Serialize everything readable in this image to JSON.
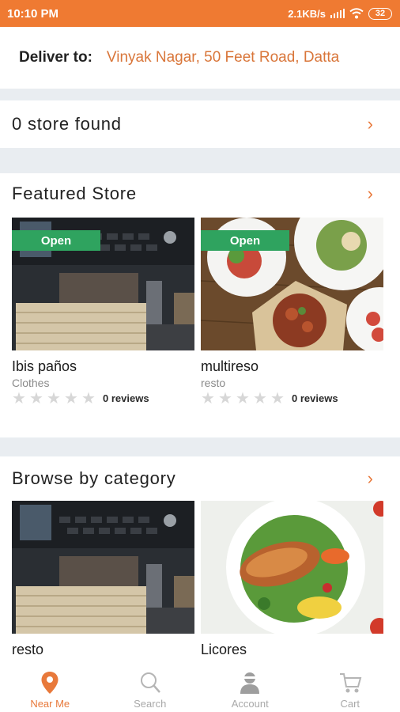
{
  "status_bar": {
    "time": "10:10 PM",
    "network_speed": "2.1KB/s",
    "battery": "32"
  },
  "deliver": {
    "label": "Deliver to:",
    "address": "Vinyak Nagar, 50 Feet Road, Datta"
  },
  "stores_found": {
    "text": "0 store found"
  },
  "featured": {
    "title": "Featured Store",
    "stores": [
      {
        "badge": "Open",
        "name": "Ibis paños",
        "category": "Clothes",
        "reviews": "0 reviews",
        "rating": 0
      },
      {
        "badge": "Open",
        "name": "multireso",
        "category": "resto",
        "reviews": "0 reviews",
        "rating": 0
      }
    ]
  },
  "browse": {
    "title": "Browse by category",
    "categories": [
      {
        "name": "resto"
      },
      {
        "name": "Licores"
      }
    ]
  },
  "nav": {
    "items": [
      {
        "label": "Near Me",
        "icon": "location-pin-icon",
        "active": true
      },
      {
        "label": "Search",
        "icon": "search-icon",
        "active": false
      },
      {
        "label": "Account",
        "icon": "account-icon",
        "active": false
      },
      {
        "label": "Cart",
        "icon": "cart-icon",
        "active": false
      }
    ]
  },
  "colors": {
    "accent": "#ef7a32",
    "open_badge": "#2fa35f",
    "divider": "#e9edf1"
  }
}
